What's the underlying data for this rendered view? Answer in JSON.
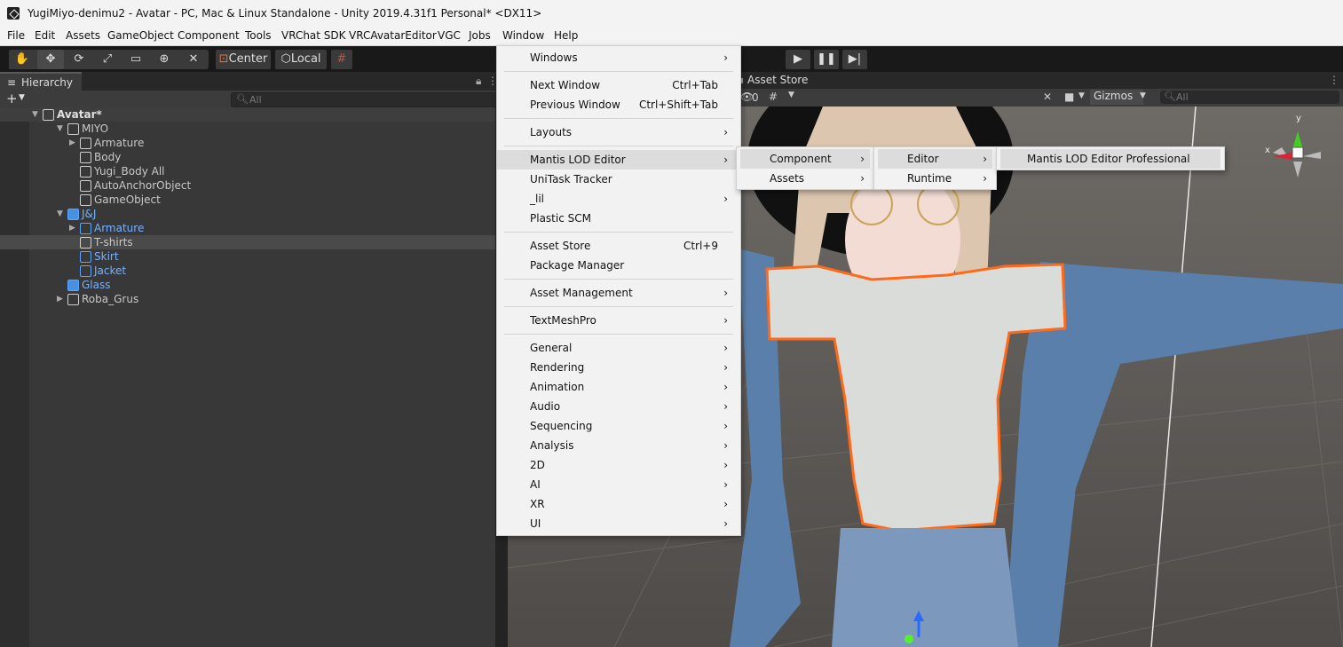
{
  "window": {
    "title": "YugiMiyo-denimu2 - Avatar - PC, Mac & Linux Standalone - Unity 2019.4.31f1 Personal* <DX11>"
  },
  "menubar": [
    "File",
    "Edit",
    "Assets",
    "GameObject",
    "Component",
    "Tools",
    "VRChat SDK",
    "VRCAvatarEditor",
    "VGC",
    "Jobs",
    "Window",
    "Help"
  ],
  "toolbar": {
    "pivot": "Center",
    "space": "Local"
  },
  "hierarchy": {
    "tab": "Hierarchy",
    "add_label": "+",
    "search_placeholder": "All",
    "rows": [
      {
        "label": "Avatar*",
        "depth": 0,
        "blue": false
      },
      {
        "label": "MIYO",
        "depth": 1,
        "blue": false
      },
      {
        "label": "Armature",
        "depth": 2,
        "blue": false
      },
      {
        "label": "Body",
        "depth": 2,
        "blue": false
      },
      {
        "label": "Yugi_Body All",
        "depth": 2,
        "blue": false
      },
      {
        "label": "AutoAnchorObject",
        "depth": 2,
        "blue": false
      },
      {
        "label": "GameObject",
        "depth": 2,
        "blue": false
      },
      {
        "label": "J&J",
        "depth": 1,
        "blue": true
      },
      {
        "label": "Armature",
        "depth": 2,
        "blue": true
      },
      {
        "label": "T-shirts",
        "depth": 2,
        "blue": false
      },
      {
        "label": "Skirt",
        "depth": 2,
        "blue": true
      },
      {
        "label": "Jacket",
        "depth": 2,
        "blue": true
      },
      {
        "label": "Glass",
        "depth": 1,
        "blue": true
      },
      {
        "label": "Roba_Grus",
        "depth": 1,
        "blue": false
      }
    ]
  },
  "scene": {
    "tab": "Asset Store",
    "gizmos": "Gizmos",
    "search_placeholder": "All",
    "hidden_count": "0",
    "axis_x": "x",
    "axis_y": "y"
  },
  "window_menu": {
    "items": [
      {
        "label": "Windows",
        "shortcut": "",
        "submenu": true
      },
      {
        "sep": true
      },
      {
        "label": "Next Window",
        "shortcut": "Ctrl+Tab",
        "submenu": false
      },
      {
        "label": "Previous Window",
        "shortcut": "Ctrl+Shift+Tab",
        "submenu": false
      },
      {
        "sep": true
      },
      {
        "label": "Layouts",
        "shortcut": "",
        "submenu": true
      },
      {
        "sep": true
      },
      {
        "label": "Mantis LOD Editor",
        "shortcut": "",
        "submenu": true,
        "highlight": true
      },
      {
        "label": "UniTask Tracker",
        "shortcut": "",
        "submenu": false
      },
      {
        "label": "_lil",
        "shortcut": "",
        "submenu": true
      },
      {
        "label": "Plastic SCM",
        "shortcut": "",
        "submenu": false
      },
      {
        "sep": true
      },
      {
        "label": "Asset Store",
        "shortcut": "Ctrl+9",
        "submenu": false
      },
      {
        "label": "Package Manager",
        "shortcut": "",
        "submenu": false
      },
      {
        "sep": true
      },
      {
        "label": "Asset Management",
        "shortcut": "",
        "submenu": true
      },
      {
        "sep": true
      },
      {
        "label": "TextMeshPro",
        "shortcut": "",
        "submenu": true
      },
      {
        "sep": true
      },
      {
        "label": "General",
        "shortcut": "",
        "submenu": true
      },
      {
        "label": "Rendering",
        "shortcut": "",
        "submenu": true
      },
      {
        "label": "Animation",
        "shortcut": "",
        "submenu": true
      },
      {
        "label": "Audio",
        "shortcut": "",
        "submenu": true
      },
      {
        "label": "Sequencing",
        "shortcut": "",
        "submenu": true
      },
      {
        "label": "Analysis",
        "shortcut": "",
        "submenu": true
      },
      {
        "label": "2D",
        "shortcut": "",
        "submenu": true
      },
      {
        "label": "AI",
        "shortcut": "",
        "submenu": true
      },
      {
        "label": "XR",
        "shortcut": "",
        "submenu": true
      },
      {
        "label": "UI",
        "shortcut": "",
        "submenu": true
      }
    ]
  },
  "mantis_submenu": {
    "items": [
      {
        "label": "Component",
        "highlight": true
      },
      {
        "label": "Assets",
        "highlight": false
      }
    ]
  },
  "component_submenu": {
    "items": [
      {
        "label": "Editor",
        "highlight": true
      },
      {
        "label": "Runtime",
        "highlight": false
      }
    ]
  },
  "editor_submenu": {
    "items": [
      {
        "label": "Mantis LOD Editor Professional",
        "highlight": true
      }
    ]
  },
  "colors": {
    "selection_outline": "#ff6a1a",
    "prefab_blue": "#76b0ff"
  }
}
